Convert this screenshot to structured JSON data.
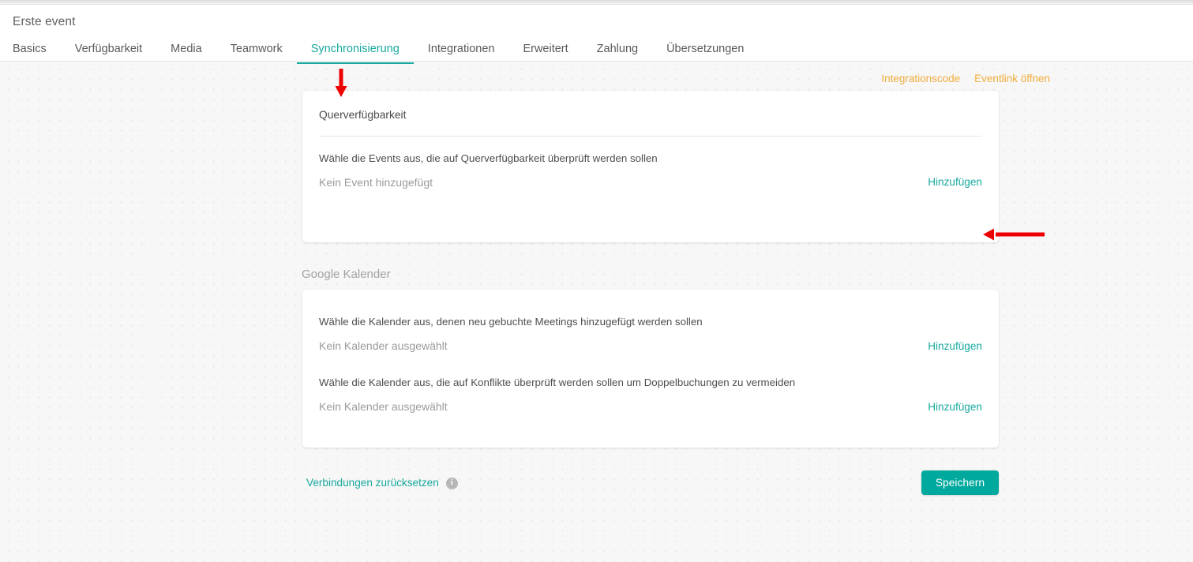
{
  "header": {
    "title": "Erste event",
    "tabs": [
      {
        "label": "Basics",
        "active": false
      },
      {
        "label": "Verfügbarkeit",
        "active": false
      },
      {
        "label": "Media",
        "active": false
      },
      {
        "label": "Teamwork",
        "active": false
      },
      {
        "label": "Synchronisierung",
        "active": true
      },
      {
        "label": "Integrationen",
        "active": false
      },
      {
        "label": "Erweitert",
        "active": false
      },
      {
        "label": "Zahlung",
        "active": false
      },
      {
        "label": "Übersetzungen",
        "active": false
      }
    ]
  },
  "quicklinks": [
    {
      "label": "Integrationscode"
    },
    {
      "label": "Eventlink öffnen"
    }
  ],
  "cross_availability_card": {
    "title": "Querverfügbarkeit",
    "description": "Wähle die Events aus, die auf Querverfügbarkeit überprüft werden sollen",
    "value": "Kein Event hinzugefügt",
    "add_label": "Hinzufügen"
  },
  "google_calendar": {
    "section_label": "Google Kalender",
    "rows": [
      {
        "description": "Wähle die Kalender aus, denen neu gebuchte Meetings hinzugefügt werden sollen",
        "value": "Kein Kalender ausgewählt",
        "add_label": "Hinzufügen"
      },
      {
        "description": "Wähle die Kalender aus, die auf Konflikte überprüft werden sollen um Doppelbuchungen zu vermeiden",
        "value": "Kein Kalender ausgewählt",
        "add_label": "Hinzufügen"
      }
    ]
  },
  "footer": {
    "reset_label": "Verbindungen zurücksetzen",
    "info_icon": "info-icon",
    "save_label": "Speichern"
  },
  "annotations": {
    "arrow_down_target": "Synchronisierung",
    "arrow_left_target": "Hinzufügen",
    "color": "#ee0000"
  },
  "colors": {
    "accent_teal": "#17a99e",
    "save_teal": "#00a99d",
    "link_amber": "#f0ad3c",
    "muted_text": "#9b9b9b",
    "background": "#f7f7f7"
  }
}
